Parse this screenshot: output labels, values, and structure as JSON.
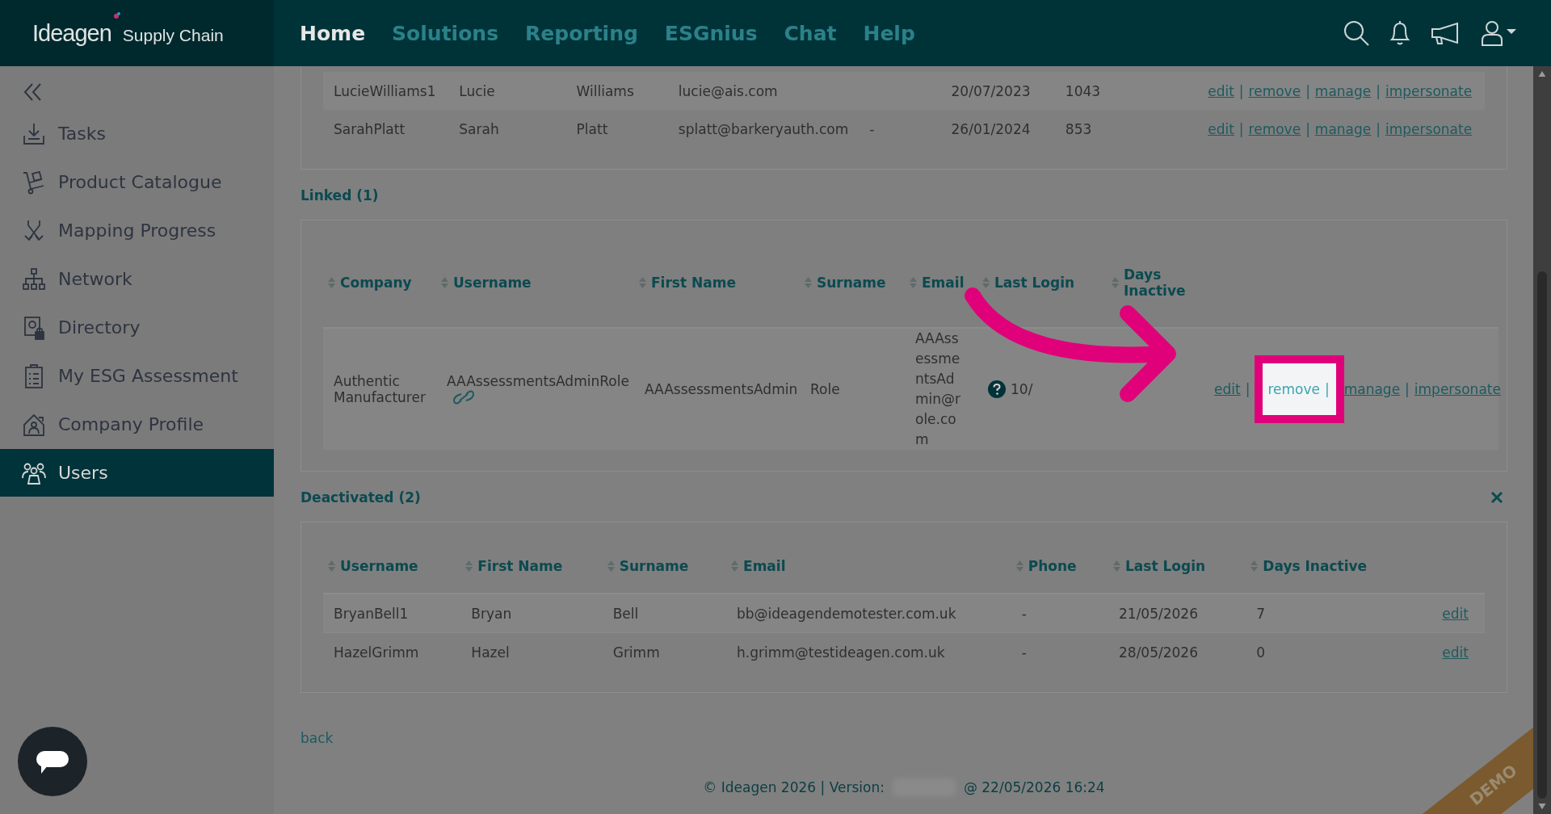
{
  "header": {
    "logo": {
      "brand": "Ideagen",
      "product": "Supply Chain"
    },
    "nav": [
      {
        "label": "Home",
        "selected": true
      },
      {
        "label": "Solutions",
        "selected": false
      },
      {
        "label": "Reporting",
        "selected": false
      },
      {
        "label": "ESGnius",
        "selected": false
      },
      {
        "label": "Chat",
        "selected": false
      },
      {
        "label": "Help",
        "selected": false
      }
    ]
  },
  "sidebar": {
    "items": [
      {
        "label": "Tasks",
        "selected": false
      },
      {
        "label": "Product Catalogue",
        "selected": false
      },
      {
        "label": "Mapping Progress",
        "selected": false
      },
      {
        "label": "Network",
        "selected": false
      },
      {
        "label": "Directory",
        "selected": false
      },
      {
        "label": "My ESG Assessment",
        "selected": false
      },
      {
        "label": "Company Profile",
        "selected": false
      },
      {
        "label": "Users",
        "selected": true
      }
    ]
  },
  "active_users": {
    "rows": [
      {
        "cells": [
          "LucieWilliams1",
          "Lucie",
          "Williams",
          "lucie@ais.com",
          "",
          "20/07/2023",
          "1043"
        ],
        "actions": [
          {
            "kind": "link",
            "label": "edit",
            "highlighted": false
          },
          {
            "kind": "separator",
            "label": "|"
          },
          {
            "kind": "link",
            "label": "remove",
            "highlighted": false
          },
          {
            "kind": "separator",
            "label": "|"
          },
          {
            "kind": "link",
            "label": "manage",
            "highlighted": false
          },
          {
            "kind": "separator",
            "label": "|"
          },
          {
            "kind": "link",
            "label": "impersonate",
            "highlighted": false
          }
        ]
      },
      {
        "cells": [
          "SarahPlatt",
          "Sarah",
          "Platt",
          "splatt@barkeryauth.com",
          "-",
          "26/01/2024",
          "853"
        ],
        "actions": [
          {
            "kind": "link",
            "label": "edit",
            "highlighted": false
          },
          {
            "kind": "separator",
            "label": "|"
          },
          {
            "kind": "link",
            "label": "remove",
            "highlighted": false
          },
          {
            "kind": "separator",
            "label": "|"
          },
          {
            "kind": "link",
            "label": "manage",
            "highlighted": false
          },
          {
            "kind": "separator",
            "label": "|"
          },
          {
            "kind": "link",
            "label": "impersonate",
            "highlighted": false
          }
        ]
      }
    ]
  },
  "linked": {
    "title": "Linked (1)",
    "columns": [
      "Company",
      "Username",
      "First Name",
      "Surname",
      "Email",
      "Last Login",
      "Days Inactive"
    ],
    "rows": [
      {
        "cells": [
          "Authentic Manufacturer",
          "AAAssessmentsAdminRole",
          "AAAssessmentsAdmin",
          "Role",
          "AAAssessmentsAdmin@role.com",
          "10/",
          ""
        ],
        "actions": [
          {
            "kind": "link",
            "label": "edit",
            "highlighted": false
          },
          {
            "kind": "separator",
            "label": "|"
          },
          {
            "kind": "link",
            "label": "remove",
            "highlighted": true
          },
          {
            "kind": "separator",
            "label": "|"
          },
          {
            "kind": "link",
            "label": "manage",
            "highlighted": false
          },
          {
            "kind": "separator",
            "label": "|"
          },
          {
            "kind": "link",
            "label": "impersonate",
            "highlighted": false
          }
        ]
      }
    ]
  },
  "deactivated": {
    "title": "Deactivated (2)",
    "columns": [
      "Username",
      "First Name",
      "Surname",
      "Email",
      "Phone",
      "Last Login",
      "Days Inactive"
    ],
    "rows": [
      {
        "cells": [
          "BryanBell1",
          "Bryan",
          "Bell",
          "bb@ideagendemotester.com.uk",
          "-",
          "21/05/2026",
          "7"
        ],
        "actions": [
          {
            "kind": "link",
            "label": "edit",
            "highlighted": false
          }
        ]
      },
      {
        "cells": [
          "HazelGrimm",
          "Hazel",
          "Grimm",
          "h.grimm@testideagen.com.uk",
          "-",
          "28/05/2026",
          "0"
        ],
        "actions": [
          {
            "kind": "link",
            "label": "edit",
            "highlighted": false
          }
        ]
      }
    ]
  },
  "back_link": "back",
  "footer": {
    "left": "© Ideagen 2026 | Version:",
    "right": "@ 22/05/2026 16:24"
  },
  "ribbon": "DEMO"
}
